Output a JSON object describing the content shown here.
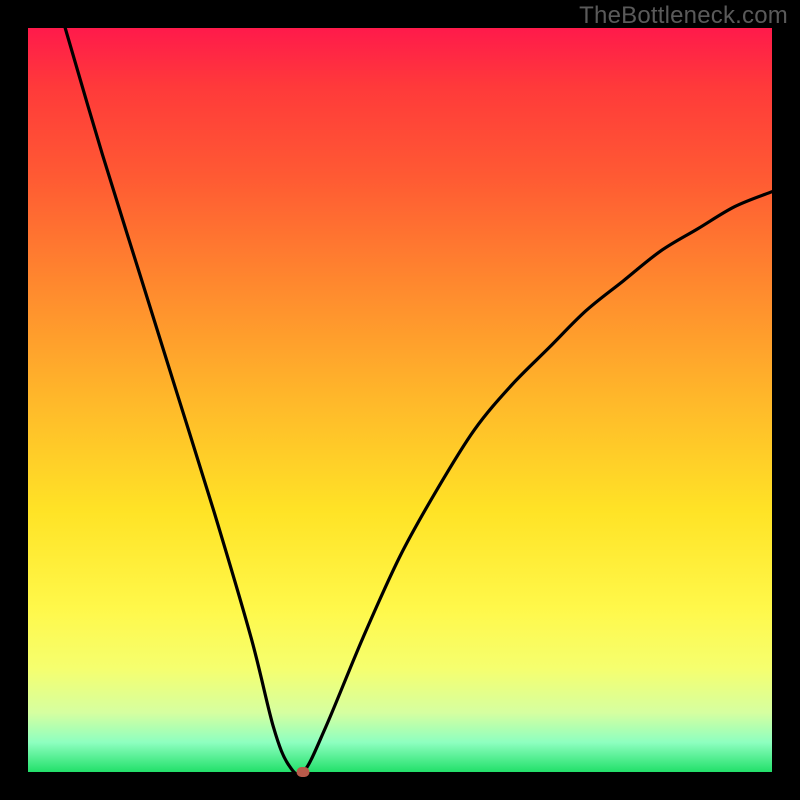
{
  "watermark_text": "TheBottleneck.com",
  "colors": {
    "frame": "#000000",
    "curve": "#000000",
    "marker": "#b85a4a",
    "watermark": "#5a5a5a"
  },
  "chart_data": {
    "type": "line",
    "title": "",
    "xlabel": "",
    "ylabel": "",
    "xlim": [
      0,
      100
    ],
    "ylim": [
      0,
      100
    ],
    "grid": false,
    "series": [
      {
        "name": "bottleneck-curve",
        "x": [
          5,
          10,
          15,
          20,
          25,
          30,
          33,
          35,
          37,
          40,
          45,
          50,
          55,
          60,
          65,
          70,
          75,
          80,
          85,
          90,
          95,
          100
        ],
        "y": [
          100,
          83,
          67,
          51,
          35,
          18,
          6,
          1,
          0,
          6,
          18,
          29,
          38,
          46,
          52,
          57,
          62,
          66,
          70,
          73,
          76,
          78
        ]
      }
    ],
    "annotations": [
      {
        "name": "minimum-marker",
        "x": 37,
        "y": 0
      }
    ]
  }
}
